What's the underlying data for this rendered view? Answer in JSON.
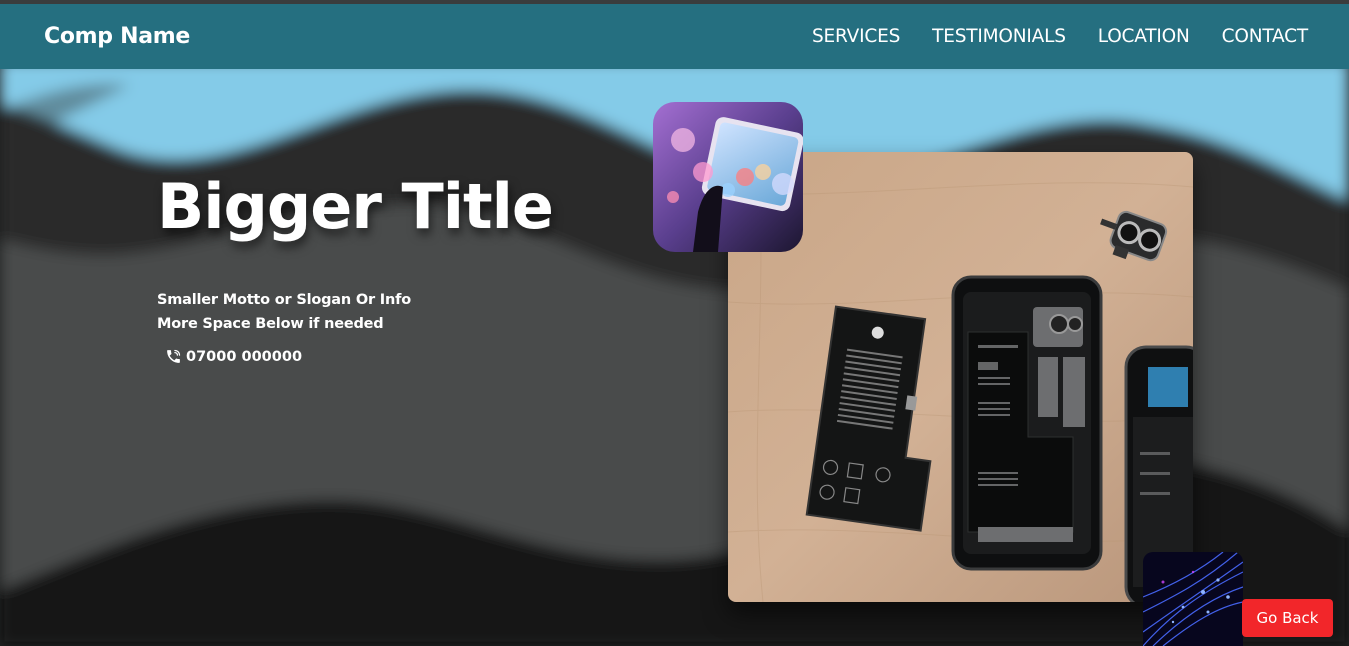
{
  "navbar": {
    "brand": "Comp Name",
    "links": [
      "SERVICES",
      "TESTIMONIALS",
      "LOCATION",
      "CONTACT"
    ]
  },
  "hero": {
    "title": "Bigger Title",
    "motto_line1": "Smaller Motto or Slogan Or Info",
    "motto_line2": "More Space Below if needed",
    "phone": "07000 000000",
    "phone_icon": "phone-icon"
  },
  "images": {
    "top_thumb": "phone-bokeh-photo",
    "main_photo": "disassembled-iphone-photo",
    "bottom_thumb": "fiber-optic-photo"
  },
  "go_back_label": "Go Back",
  "colors": {
    "navbar": "#256f80",
    "sky_wave": "#84cbe8",
    "go_back": "#f2262a",
    "background": "#1c1e1e"
  }
}
